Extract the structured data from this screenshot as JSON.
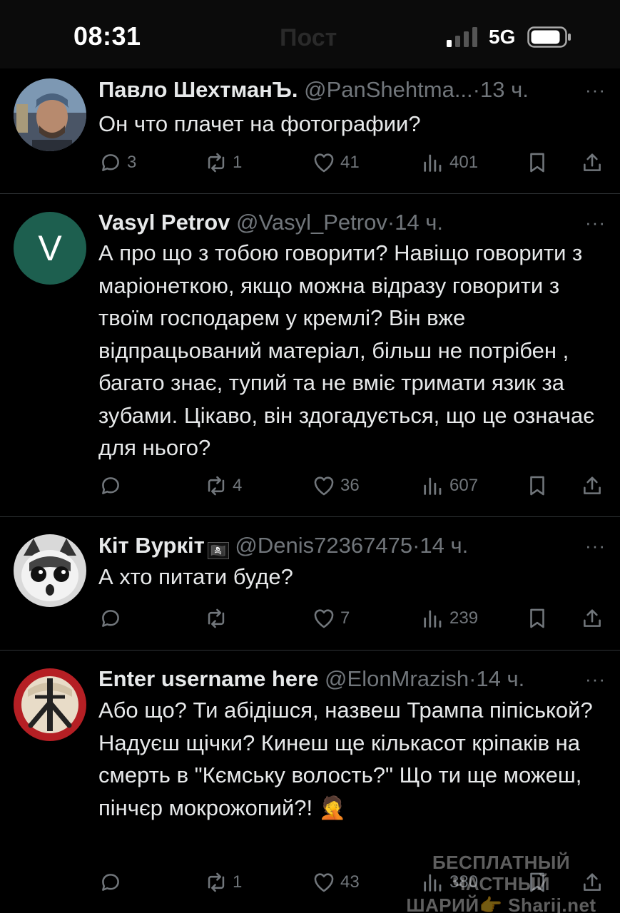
{
  "status_bar": {
    "time": "08:31",
    "obscured_title": "Пост",
    "network": "5G",
    "icons": [
      "signal-icon",
      "battery-icon"
    ]
  },
  "tweets": [
    {
      "name": "Павло ШехтманЪ.",
      "handle": "@PanShehtma...",
      "dot": "·",
      "time": "13 ч.",
      "more": "···",
      "text": "Он что плачет на фотографии?",
      "replies": "3",
      "reposts": "1",
      "likes": "41",
      "views": "401"
    },
    {
      "name": "Vasyl Petrov",
      "avatar_letter": "V",
      "handle": "@Vasyl_Petrov",
      "dot": "·",
      "time": "14 ч.",
      "more": "···",
      "text": "А про що з тобою говорити? Навіщо говорити з маріонеткою, якщо можна відразу говорити з твоїм господарем у кремлі? Він вже відпрацьований матеріал, більш не потрібен , багато знає, тупий та не вміє тримати язик за зубами. Цікаво, він здогадується, що це означає для нього?",
      "replies": "",
      "reposts": "4",
      "likes": "36",
      "views": "607"
    },
    {
      "name": "Кіт Вуркіт",
      "flag": "🏴‍☠️",
      "handle": "@Denis72367475",
      "dot": "·",
      "time": "14 ч.",
      "more": "···",
      "text": "А хто питати буде?",
      "replies": "",
      "reposts": "",
      "likes": "7",
      "views": "239"
    },
    {
      "name": "Enter username here",
      "handle": "@ElonMrazish",
      "dot": "·",
      "time": "14 ч.",
      "more": "···",
      "text": "Або що? Ти абідішся, назвеш Трампа піпіськой? Надуєш щічки? Кинеш ще кількасот кріпаків на смерть в \"Кємську волость?\" Що ти ще можеш, пінчєр мокрожопий?! 🤦",
      "replies": "",
      "reposts": "1",
      "likes": "43",
      "views": "380"
    }
  ],
  "watermark": {
    "line1": "БЕСПЛАТНЫЙ ЧАСТНЫЙ",
    "line2": "ШАРИЙ👉 Sharij.net"
  }
}
